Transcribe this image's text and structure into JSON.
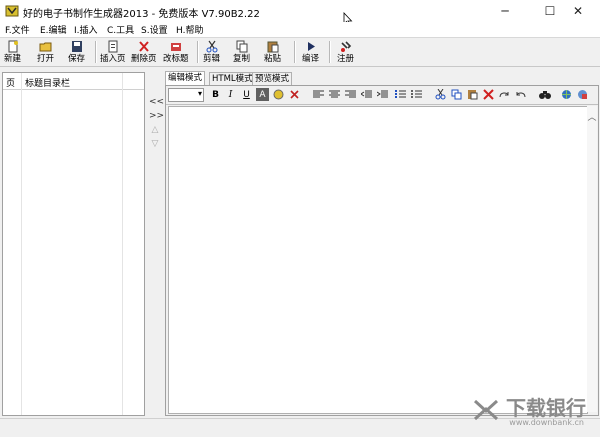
{
  "window": {
    "title": "好的电子书制作生成器2013  - 免费版本 V7.90B2.22",
    "minimize_glyph": "─",
    "maximize_glyph": "☐",
    "close_glyph": "✕"
  },
  "menu": [
    "F.文件",
    "E.编辑",
    "I.插入",
    "C.工具",
    "S.设置",
    "H.帮助"
  ],
  "toolbar": {
    "new": "新建",
    "open": "打开",
    "save": "保存",
    "insert_page": "插入页",
    "delete_page": "删除页",
    "rename_title": "改标题",
    "cut": "剪辑",
    "copy": "复制",
    "paste": "粘贴",
    "compile": "编译",
    "register": "注册"
  },
  "left_panel": {
    "col_page": "页",
    "col_title": "标题目录栏"
  },
  "nav_arrows": [
    "<<",
    ">>",
    "△",
    "▽"
  ],
  "tabs": [
    "编辑模式",
    "HTML模式",
    "预览模式"
  ],
  "format_bar": {
    "bold": "B",
    "italic": "I",
    "underline": "U",
    "font_color": "A"
  },
  "watermark": {
    "main": "下载银行",
    "sub": "www.downbank.cn"
  },
  "colors": {
    "delete_red": "#d02020",
    "toolbar_bg": "#f0f0f0"
  }
}
